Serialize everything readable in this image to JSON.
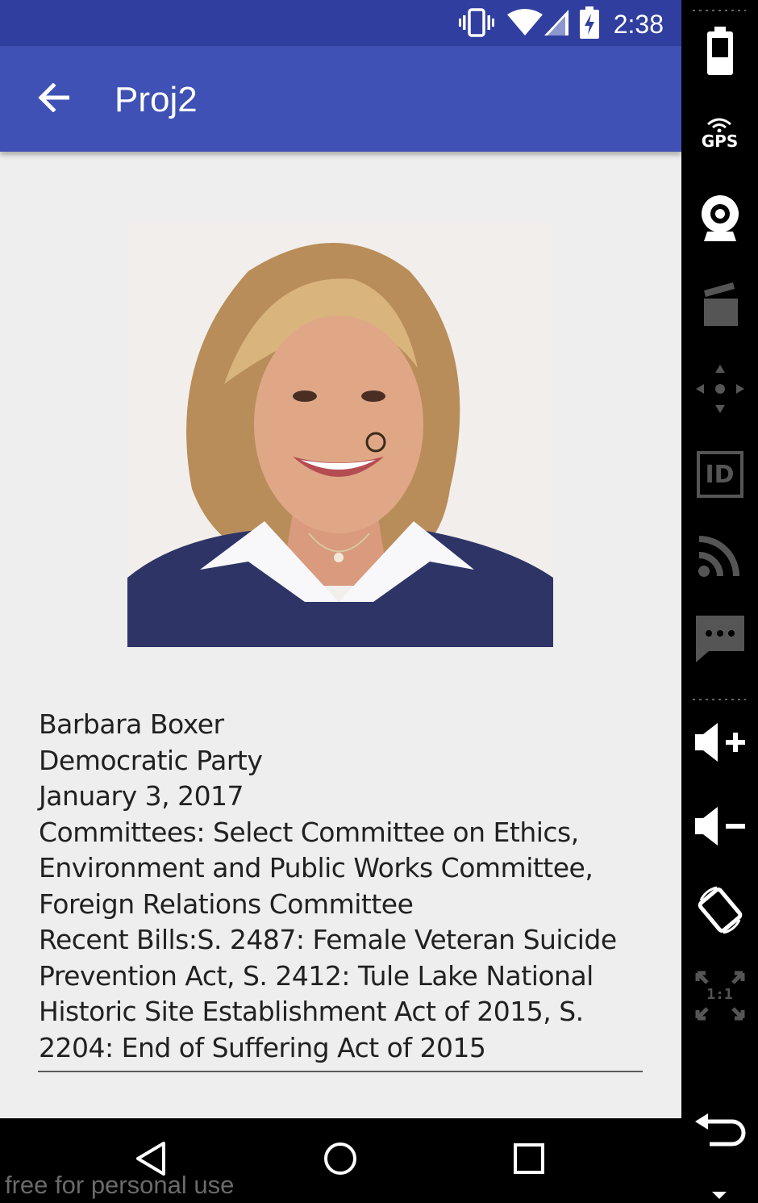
{
  "status_bar": {
    "time": "2:38",
    "icons": [
      "vibrate-icon",
      "wifi-icon",
      "cell-signal-icon",
      "battery-charging-icon"
    ]
  },
  "app_bar": {
    "title": "Proj2",
    "back_icon": "arrow-back-icon",
    "color": "#3f51b5",
    "status_color": "#303f9f"
  },
  "legislator": {
    "photo": "portrait-photo",
    "name": "Barbara Boxer",
    "party": "Democratic Party",
    "term_end": "January 3, 2017",
    "committees": "Committees: Select Committee on Ethics, Environment and Public Works Committee, Foreign Relations Committee",
    "bills": "Recent Bills:S. 2487: Female Veteran Suicide Prevention Act, S. 2412: Tule Lake National Historic Site Establishment Act of 2015, S. 2204: End of Suffering Act of 2015"
  },
  "nav_bar": {
    "buttons": [
      "back-triangle-icon",
      "home-circle-icon",
      "recents-square-icon"
    ]
  },
  "watermark": "free for personal use",
  "emulator_panel": {
    "gps_label": "GPS",
    "id_label": "ID",
    "ratio_label": "1:1",
    "buttons": [
      "battery-icon",
      "gps-icon",
      "camera-icon",
      "media-icon",
      "dpad-icon",
      "id-icon",
      "cast-icon",
      "sms-icon",
      "volume-up-icon",
      "volume-down-icon",
      "rotate-icon",
      "scale-icon",
      "back-icon"
    ]
  }
}
